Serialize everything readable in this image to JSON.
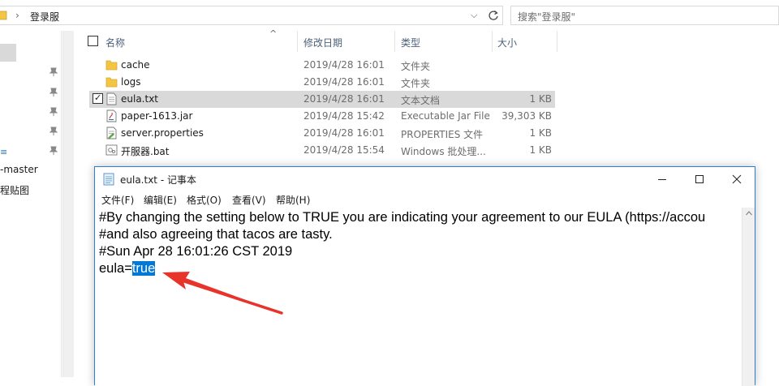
{
  "explorer": {
    "address": {
      "separator": "›",
      "path": "登录服",
      "dropdown": "⌵"
    },
    "search": {
      "placeholder": "搜索\"登录服\""
    },
    "columns": {
      "name": "名称",
      "modified": "修改日期",
      "type": "类型",
      "size": "大小"
    },
    "nav": {
      "items": [
        {
          "label": "-master"
        },
        {
          "label": "程贴图"
        }
      ],
      "accent_glyph": "≡"
    },
    "files": [
      {
        "name": "cache",
        "date": "2019/4/28 16:01",
        "type": "文件夹",
        "size": "",
        "icon": "folder-icon",
        "selected": false
      },
      {
        "name": "logs",
        "date": "2019/4/28 16:01",
        "type": "文件夹",
        "size": "",
        "icon": "folder-icon",
        "selected": false
      },
      {
        "name": "eula.txt",
        "date": "2019/4/28 16:01",
        "type": "文本文档",
        "size": "1 KB",
        "icon": "text-file-icon",
        "selected": true
      },
      {
        "name": "paper-1613.jar",
        "date": "2019/4/28 15:42",
        "type": "Executable Jar File",
        "size": "39,303 KB",
        "icon": "jar-file-icon",
        "selected": false
      },
      {
        "name": "server.properties",
        "date": "2019/4/28 16:01",
        "type": "PROPERTIES 文件",
        "size": "1 KB",
        "icon": "properties-file-icon",
        "selected": false
      },
      {
        "name": "开服器.bat",
        "date": "2019/4/28 15:54",
        "type": "Windows 批处理...",
        "size": "1 KB",
        "icon": "bat-file-icon",
        "selected": false
      }
    ]
  },
  "notepad": {
    "title": "eula.txt - 记事本",
    "menus": [
      "文件(F)",
      "编辑(E)",
      "格式(O)",
      "查看(V)",
      "帮助(H)"
    ],
    "lines": [
      "#By changing the setting below to TRUE you are indicating your agreement to our EULA (https://accou",
      "#and also agreeing that tacos are tasty.",
      "#Sun Apr 28 16:01:26 CST 2019"
    ],
    "last_line": {
      "prefix": "eula=",
      "highlighted": "true"
    }
  },
  "colors": {
    "selection": "#0078d7",
    "window_border": "#2d7dd2",
    "arrow": "#e8332a",
    "folder": "#f4c542"
  }
}
